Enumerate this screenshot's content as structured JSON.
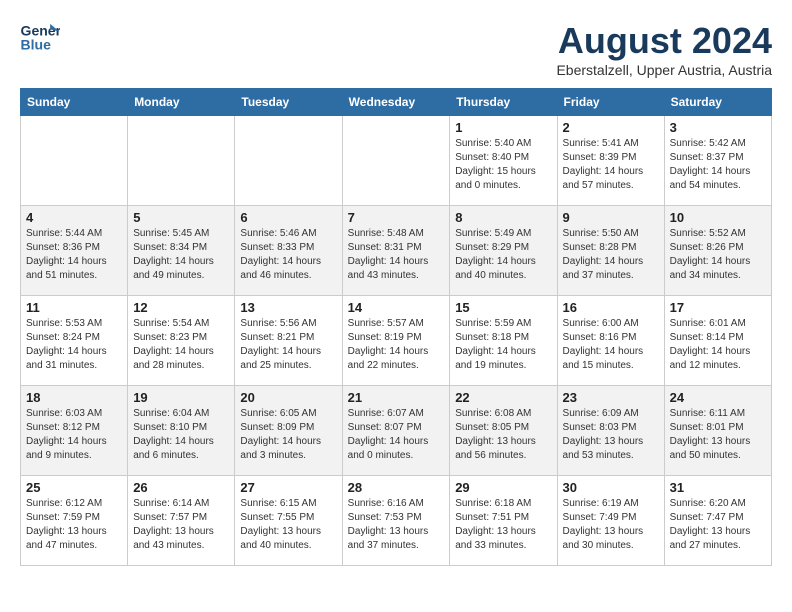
{
  "header": {
    "logo_line1": "General",
    "logo_line2": "Blue",
    "month_title": "August 2024",
    "location": "Eberstalzell, Upper Austria, Austria"
  },
  "weekdays": [
    "Sunday",
    "Monday",
    "Tuesday",
    "Wednesday",
    "Thursday",
    "Friday",
    "Saturday"
  ],
  "weeks": [
    [
      {
        "day": "",
        "info": ""
      },
      {
        "day": "",
        "info": ""
      },
      {
        "day": "",
        "info": ""
      },
      {
        "day": "",
        "info": ""
      },
      {
        "day": "1",
        "info": "Sunrise: 5:40 AM\nSunset: 8:40 PM\nDaylight: 15 hours\nand 0 minutes."
      },
      {
        "day": "2",
        "info": "Sunrise: 5:41 AM\nSunset: 8:39 PM\nDaylight: 14 hours\nand 57 minutes."
      },
      {
        "day": "3",
        "info": "Sunrise: 5:42 AM\nSunset: 8:37 PM\nDaylight: 14 hours\nand 54 minutes."
      }
    ],
    [
      {
        "day": "4",
        "info": "Sunrise: 5:44 AM\nSunset: 8:36 PM\nDaylight: 14 hours\nand 51 minutes."
      },
      {
        "day": "5",
        "info": "Sunrise: 5:45 AM\nSunset: 8:34 PM\nDaylight: 14 hours\nand 49 minutes."
      },
      {
        "day": "6",
        "info": "Sunrise: 5:46 AM\nSunset: 8:33 PM\nDaylight: 14 hours\nand 46 minutes."
      },
      {
        "day": "7",
        "info": "Sunrise: 5:48 AM\nSunset: 8:31 PM\nDaylight: 14 hours\nand 43 minutes."
      },
      {
        "day": "8",
        "info": "Sunrise: 5:49 AM\nSunset: 8:29 PM\nDaylight: 14 hours\nand 40 minutes."
      },
      {
        "day": "9",
        "info": "Sunrise: 5:50 AM\nSunset: 8:28 PM\nDaylight: 14 hours\nand 37 minutes."
      },
      {
        "day": "10",
        "info": "Sunrise: 5:52 AM\nSunset: 8:26 PM\nDaylight: 14 hours\nand 34 minutes."
      }
    ],
    [
      {
        "day": "11",
        "info": "Sunrise: 5:53 AM\nSunset: 8:24 PM\nDaylight: 14 hours\nand 31 minutes."
      },
      {
        "day": "12",
        "info": "Sunrise: 5:54 AM\nSunset: 8:23 PM\nDaylight: 14 hours\nand 28 minutes."
      },
      {
        "day": "13",
        "info": "Sunrise: 5:56 AM\nSunset: 8:21 PM\nDaylight: 14 hours\nand 25 minutes."
      },
      {
        "day": "14",
        "info": "Sunrise: 5:57 AM\nSunset: 8:19 PM\nDaylight: 14 hours\nand 22 minutes."
      },
      {
        "day": "15",
        "info": "Sunrise: 5:59 AM\nSunset: 8:18 PM\nDaylight: 14 hours\nand 19 minutes."
      },
      {
        "day": "16",
        "info": "Sunrise: 6:00 AM\nSunset: 8:16 PM\nDaylight: 14 hours\nand 15 minutes."
      },
      {
        "day": "17",
        "info": "Sunrise: 6:01 AM\nSunset: 8:14 PM\nDaylight: 14 hours\nand 12 minutes."
      }
    ],
    [
      {
        "day": "18",
        "info": "Sunrise: 6:03 AM\nSunset: 8:12 PM\nDaylight: 14 hours\nand 9 minutes."
      },
      {
        "day": "19",
        "info": "Sunrise: 6:04 AM\nSunset: 8:10 PM\nDaylight: 14 hours\nand 6 minutes."
      },
      {
        "day": "20",
        "info": "Sunrise: 6:05 AM\nSunset: 8:09 PM\nDaylight: 14 hours\nand 3 minutes."
      },
      {
        "day": "21",
        "info": "Sunrise: 6:07 AM\nSunset: 8:07 PM\nDaylight: 14 hours\nand 0 minutes."
      },
      {
        "day": "22",
        "info": "Sunrise: 6:08 AM\nSunset: 8:05 PM\nDaylight: 13 hours\nand 56 minutes."
      },
      {
        "day": "23",
        "info": "Sunrise: 6:09 AM\nSunset: 8:03 PM\nDaylight: 13 hours\nand 53 minutes."
      },
      {
        "day": "24",
        "info": "Sunrise: 6:11 AM\nSunset: 8:01 PM\nDaylight: 13 hours\nand 50 minutes."
      }
    ],
    [
      {
        "day": "25",
        "info": "Sunrise: 6:12 AM\nSunset: 7:59 PM\nDaylight: 13 hours\nand 47 minutes."
      },
      {
        "day": "26",
        "info": "Sunrise: 6:14 AM\nSunset: 7:57 PM\nDaylight: 13 hours\nand 43 minutes."
      },
      {
        "day": "27",
        "info": "Sunrise: 6:15 AM\nSunset: 7:55 PM\nDaylight: 13 hours\nand 40 minutes."
      },
      {
        "day": "28",
        "info": "Sunrise: 6:16 AM\nSunset: 7:53 PM\nDaylight: 13 hours\nand 37 minutes."
      },
      {
        "day": "29",
        "info": "Sunrise: 6:18 AM\nSunset: 7:51 PM\nDaylight: 13 hours\nand 33 minutes."
      },
      {
        "day": "30",
        "info": "Sunrise: 6:19 AM\nSunset: 7:49 PM\nDaylight: 13 hours\nand 30 minutes."
      },
      {
        "day": "31",
        "info": "Sunrise: 6:20 AM\nSunset: 7:47 PM\nDaylight: 13 hours\nand 27 minutes."
      }
    ]
  ]
}
